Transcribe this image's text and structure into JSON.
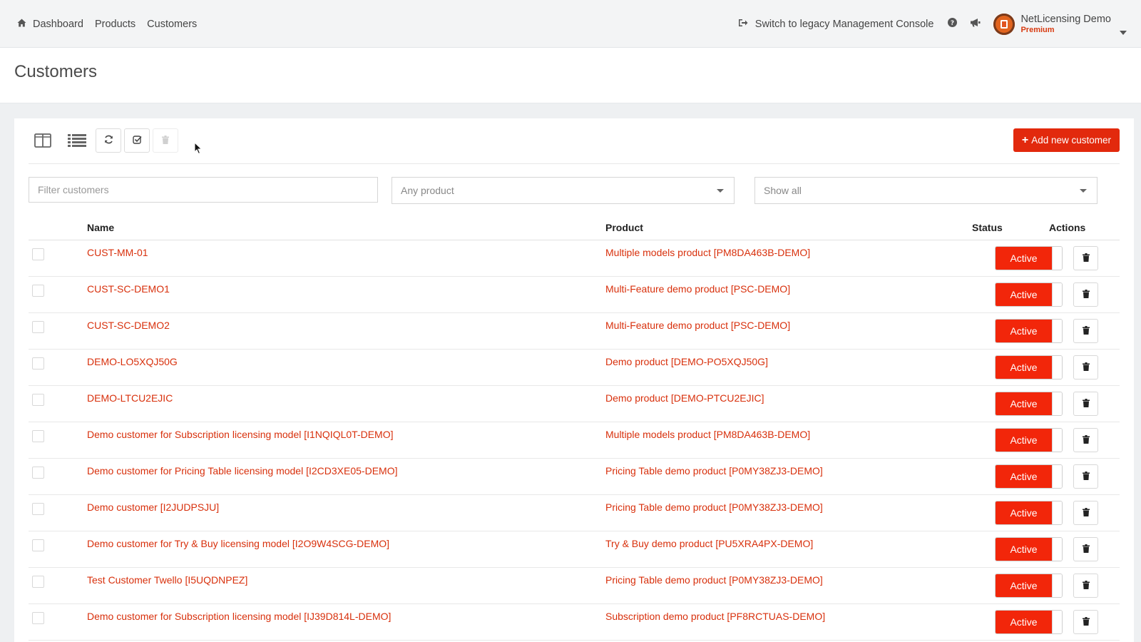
{
  "nav": {
    "dashboard": "Dashboard",
    "products": "Products",
    "customers": "Customers",
    "legacy": "Switch to legacy Management Console",
    "account_name": "NetLicensing Demo",
    "account_plan": "Premium"
  },
  "page": {
    "title": "Customers"
  },
  "toolbar": {
    "add_label": "Add new customer"
  },
  "filters": {
    "search_placeholder": "Filter customers",
    "product_selected": "Any product",
    "status_selected": "Show all"
  },
  "table": {
    "headers": {
      "name": "Name",
      "product": "Product",
      "status": "Status",
      "actions": "Actions"
    },
    "rows": [
      {
        "name": "CUST-MM-01",
        "product": "Multiple models product [PM8DA463B-DEMO]",
        "status": "Active"
      },
      {
        "name": "CUST-SC-DEMO1",
        "product": "Multi-Feature demo product [PSC-DEMO]",
        "status": "Active"
      },
      {
        "name": "CUST-SC-DEMO2",
        "product": "Multi-Feature demo product [PSC-DEMO]",
        "status": "Active"
      },
      {
        "name": "DEMO-LO5XQJ50G",
        "product": "Demo product [DEMO-PO5XQJ50G]",
        "status": "Active"
      },
      {
        "name": "DEMO-LTCU2EJIC",
        "product": "Demo product [DEMO-PTCU2EJIC]",
        "status": "Active"
      },
      {
        "name": "Demo customer for Subscription licensing model [I1NQIQL0T-DEMO]",
        "product": "Multiple models product [PM8DA463B-DEMO]",
        "status": "Active"
      },
      {
        "name": "Demo customer for Pricing Table licensing model [I2CD3XE05-DEMO]",
        "product": "Pricing Table demo product [P0MY38ZJ3-DEMO]",
        "status": "Active"
      },
      {
        "name": "Demo customer [I2JUDPSJU]",
        "product": "Pricing Table demo product [P0MY38ZJ3-DEMO]",
        "status": "Active"
      },
      {
        "name": "Demo customer for Try & Buy licensing model [I2O9W4SCG-DEMO]",
        "product": "Try & Buy demo product [PU5XRA4PX-DEMO]",
        "status": "Active"
      },
      {
        "name": "Test Customer Twello [I5UQDNPEZ]",
        "product": "Pricing Table demo product [P0MY38ZJ3-DEMO]",
        "status": "Active"
      },
      {
        "name": "Demo customer for Subscription licensing model [IJ39D814L-DEMO]",
        "product": "Subscription demo product [PF8RCTUAS-DEMO]",
        "status": "Active"
      }
    ]
  },
  "colors": {
    "accent": "#e2290d",
    "link": "#d8300c",
    "status_active": "#f2260a"
  },
  "icons": [
    "home-icon",
    "sign-out-icon",
    "question-circle-icon",
    "bullhorn-icon",
    "columns-icon",
    "list-icon",
    "refresh-icon",
    "check-square-icon",
    "trash-icon",
    "plus-icon",
    "caret-down-icon"
  ]
}
